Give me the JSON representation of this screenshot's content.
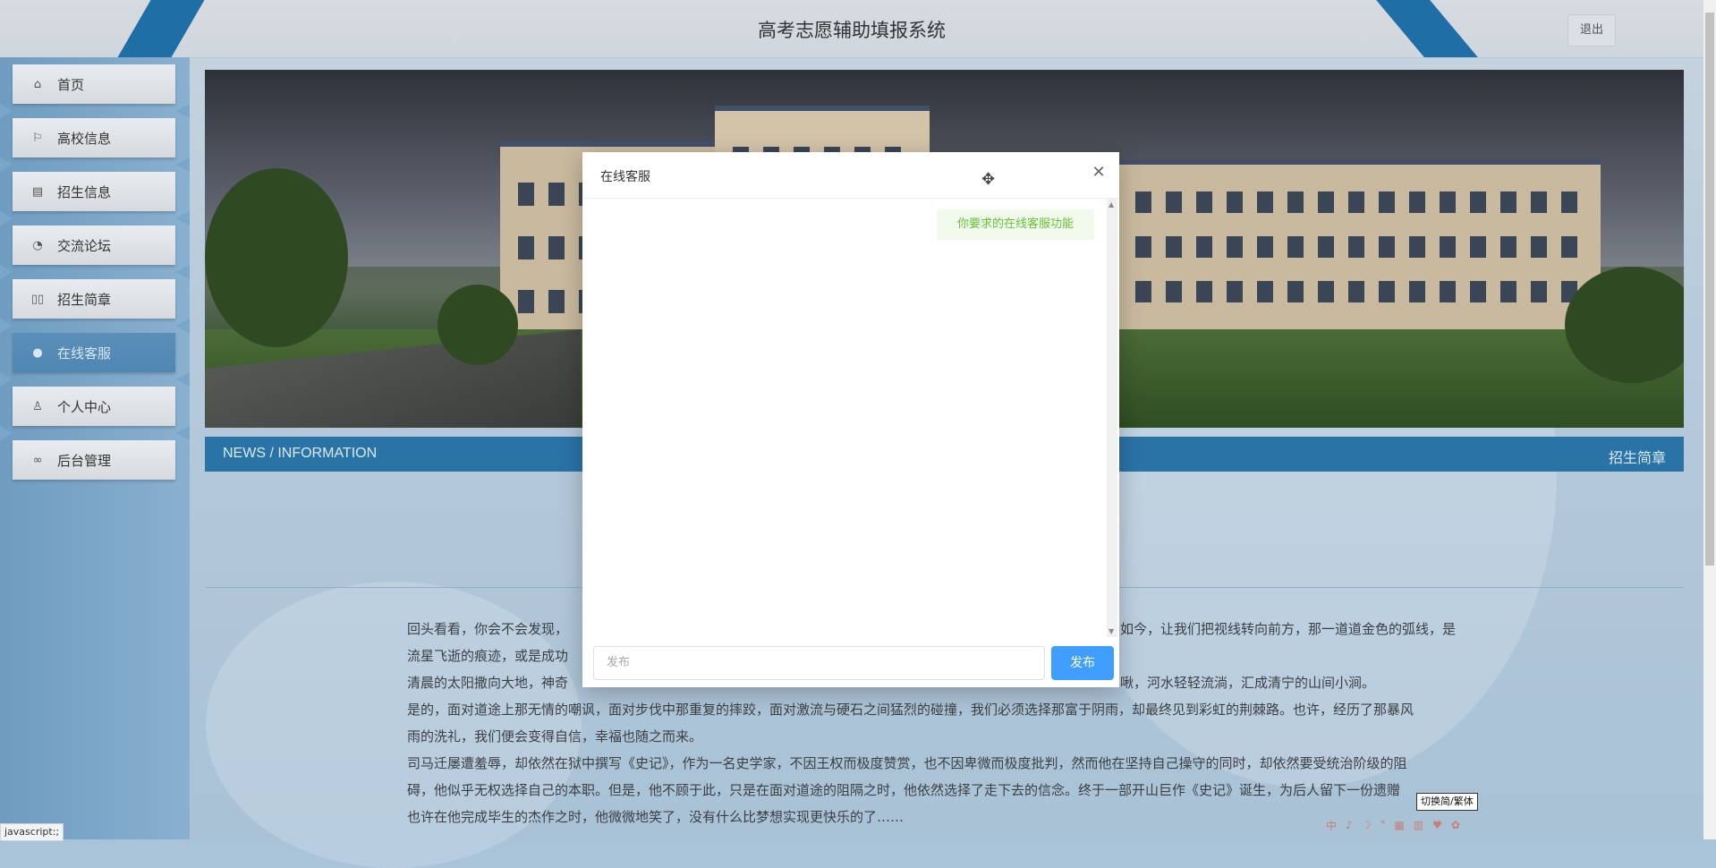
{
  "header": {
    "title": "高考志愿辅助填报系统",
    "logout_label": "退出"
  },
  "sidebar": {
    "items": [
      {
        "label": "首页",
        "icon": "home-icon",
        "glyph": "⌂"
      },
      {
        "label": "高校信息",
        "icon": "flag-icon",
        "glyph": "⚐"
      },
      {
        "label": "招生信息",
        "icon": "calendar-icon",
        "glyph": "▤"
      },
      {
        "label": "交流论坛",
        "icon": "palette-icon",
        "glyph": "◔"
      },
      {
        "label": "招生简章",
        "icon": "book-icon",
        "glyph": "▯▯"
      },
      {
        "label": "在线客服",
        "icon": "service-icon",
        "glyph": "●",
        "active": true
      },
      {
        "label": "个人中心",
        "icon": "user-icon",
        "glyph": "♙"
      },
      {
        "label": "后台管理",
        "icon": "link-icon",
        "glyph": "∞"
      }
    ]
  },
  "news_bar": {
    "left_label": "NEWS / INFORMATION",
    "right_label": "招生简章"
  },
  "article": {
    "paragraphs": [
      "回头看看，你会不会发现，",
      "流星飞逝的痕迹，或是成功",
      "清晨的太阳撒向大地，神奇",
      "是的，面对道途上那无情的嘲讽，面对步伐中那重复的摔跤，面对激流与硬石之间猛烈的碰撞，我们必须选择那富于阴雨，却最终见到彩虹的荆棘路。也许，经历了那暴风",
      "雨的洗礼，我们便会变得自信，幸福也随之而来。",
      "司马迁屡遭羞辱，却依然在狱中撰写《史记》，作为一名史学家，不因王权而极度赞赏，也不因卑微而极度批判，然而他在坚持自己操守的同时，却依然要受统治阶级的阻",
      "碍，他似乎无权选择自己的本职。但是，他不顾于此，只是在面对道途的阻隔之时，他依然选择了走下去的信念。终于一部开山巨作《史记》诞生，为后人留下一份遗赠",
      "也许在他完成毕生的杰作之时，他微微地笑了，没有什么比梦想实现更快乐的了……"
    ],
    "right_fragments": [
      "如今，让我们把视线转向前方，那一道道金色的弧线，是",
      "啾，河水轻轻流淌，汇成清宁的山间小涧。"
    ]
  },
  "modal": {
    "title": "在线客服",
    "message": "你要求的在线客服功能",
    "input_placeholder": "发布",
    "send_label": "发布"
  },
  "status_bar": {
    "url": "javascript:;"
  },
  "tooltip": "切换简/繁体",
  "ime": [
    "中",
    "♪",
    "☽",
    "°",
    "▦",
    "▥",
    "♥",
    "✿"
  ],
  "colors": {
    "accent": "#2a73a7",
    "send_button": "#409eff",
    "bubble_bg": "#f0f9eb",
    "bubble_text": "#67c23a"
  }
}
